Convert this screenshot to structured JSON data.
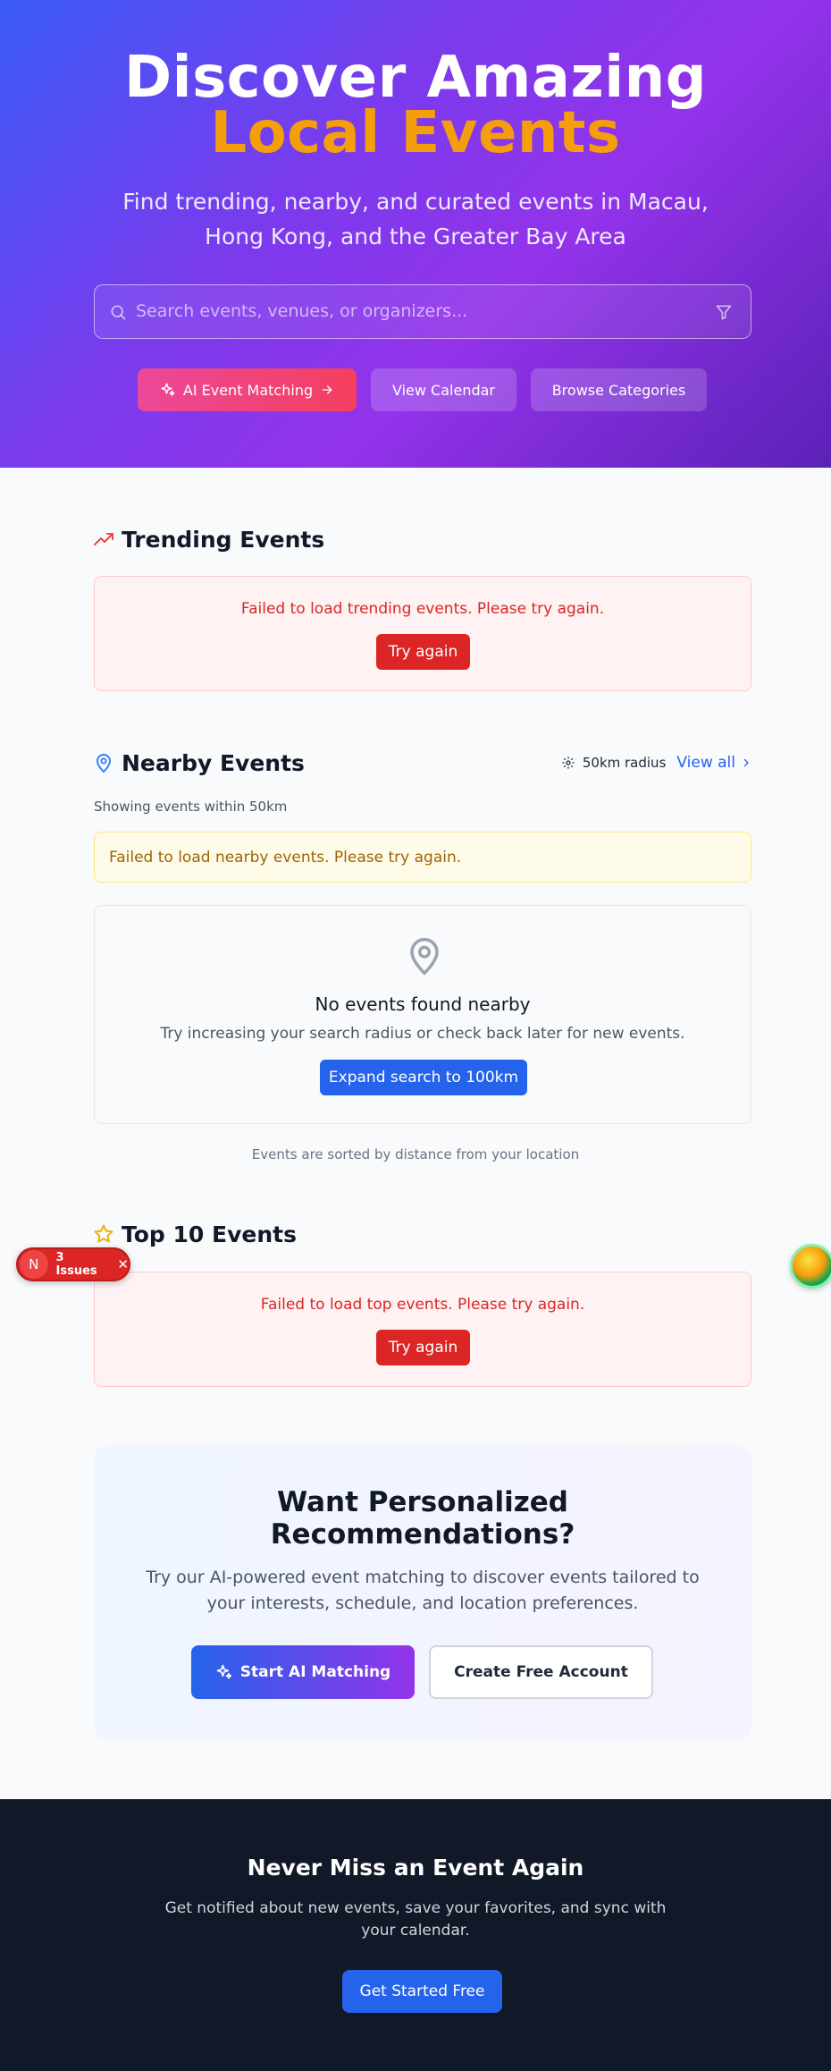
{
  "hero": {
    "title_line1": "Discover Amazing",
    "title_line2": "Local Events",
    "subtitle": "Find trending, nearby, and curated events in Macau, Hong Kong, and the Greater Bay Area",
    "search_placeholder": "Search events, venues, or organizers...",
    "buttons": {
      "ai_matching": "AI Event Matching",
      "view_calendar": "View Calendar",
      "browse_categories": "Browse Categories"
    }
  },
  "trending": {
    "title": "Trending Events",
    "error": "Failed to load trending events. Please try again.",
    "retry": "Try again"
  },
  "nearby": {
    "title": "Nearby Events",
    "radius": "50km radius",
    "view_all": "View all",
    "showing": "Showing events within 50km",
    "warning": "Failed to load nearby events. Please try again.",
    "empty_title": "No events found nearby",
    "empty_desc": "Try increasing your search radius or check back later for new events.",
    "expand": "Expand search to 100km",
    "sorted_note": "Events are sorted by distance from your location"
  },
  "top10": {
    "title": "Top 10 Events",
    "error": "Failed to load top events. Please try again.",
    "retry": "Try again"
  },
  "dev_badge": {
    "logo": "N",
    "issues": "3 Issues"
  },
  "promo": {
    "title_line1": "Want Personalized",
    "title_line2": "Recommendations?",
    "desc": "Try our AI-powered event matching to discover events tailored to your interests, schedule, and location preferences.",
    "start_ai": "Start AI Matching",
    "create_account": "Create Free Account"
  },
  "cta": {
    "title": "Never Miss an Event Again",
    "desc": "Get notified about new events, save your favorites, and sync with your calendar.",
    "button": "Get Started Free"
  },
  "colors": {
    "accent_orange": "#f59e0b",
    "error_red": "#dc2626",
    "primary_blue": "#2563eb",
    "footer_dark": "#111827"
  }
}
